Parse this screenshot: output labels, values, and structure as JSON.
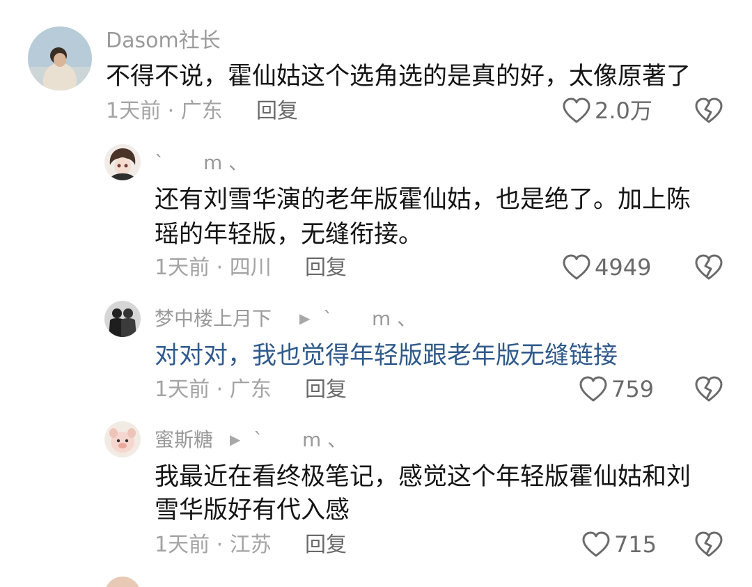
{
  "comments": [
    {
      "username": "Dasom社长",
      "text_lines": [
        "不得不说，霍仙姑这个选角选的是真的好，太像原著了"
      ],
      "meta": "1天前 · 广东",
      "reply_label": "回复",
      "likes": "2.0万"
    },
    {
      "username": "`　　m 、",
      "text_lines": [
        "还有刘雪华演的老年版霍仙姑，也是绝了。加上陈",
        "瑶的年轻版，无缝衔接。"
      ],
      "meta": "1天前 · 四川",
      "reply_label": "回复",
      "likes": "4949"
    },
    {
      "username": "梦中楼上月下",
      "reply_to": "`　　m 、",
      "text_lines": [
        "对对对，我也觉得年轻版跟老年版无缝链接"
      ],
      "meta": "1天前 · 广东",
      "reply_label": "回复",
      "likes": "759"
    },
    {
      "username": "蜜斯糖",
      "reply_to": "`　　m 、",
      "text_lines": [
        "我最近在看终极笔记，感觉这个年轻版霍仙姑和刘",
        "雪华版好有代入感"
      ],
      "meta": "1天前 · 江苏",
      "reply_label": "回复",
      "likes": "715"
    }
  ],
  "icons": {
    "like": "heart-outline-icon",
    "dislike": "broken-heart-icon",
    "reply_arrow": "triangle-right-icon"
  },
  "colors": {
    "text": "#141414",
    "reply_text_link": "#2f5a8c",
    "muted": "#9a9a9a"
  }
}
